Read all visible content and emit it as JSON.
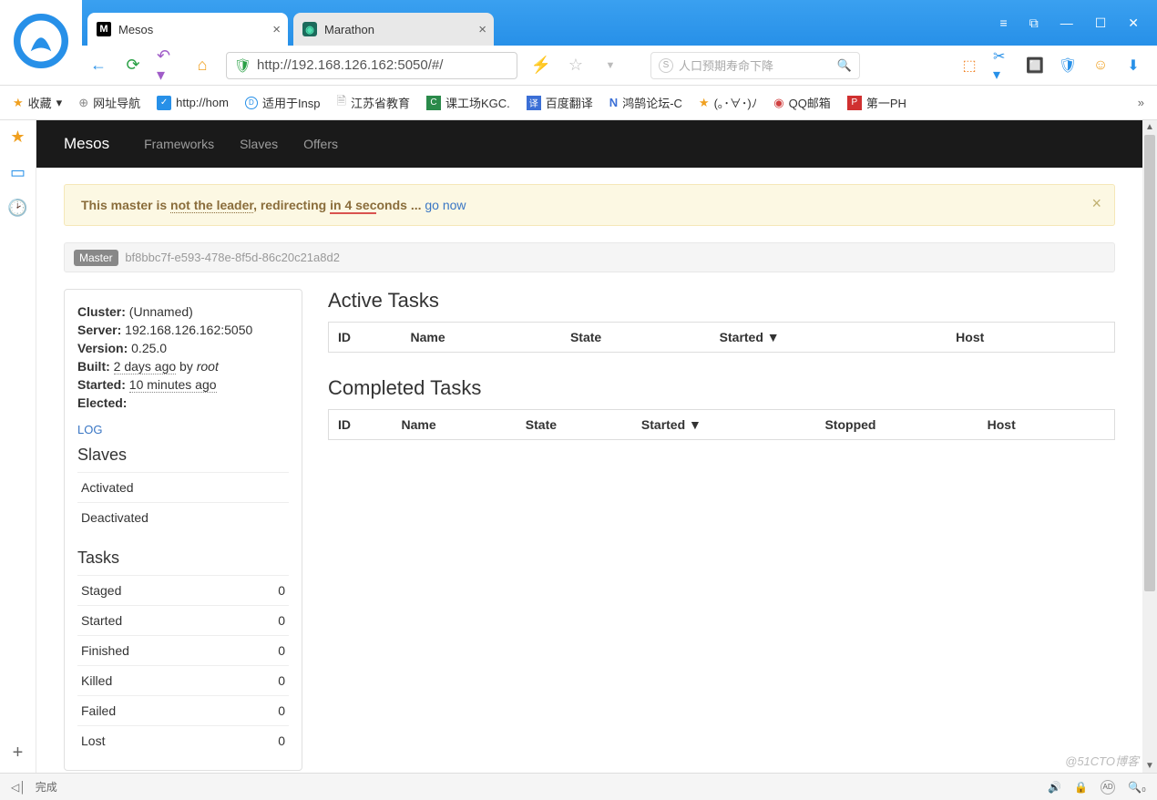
{
  "browser": {
    "tabs": [
      {
        "title": "Mesos",
        "active": true
      },
      {
        "title": "Marathon",
        "active": false
      }
    ],
    "url": "http://192.168.126.162:5050/#/",
    "search_placeholder": "人口预期寿命下降",
    "bookmarks": [
      {
        "label": "收藏"
      },
      {
        "label": "网址导航"
      },
      {
        "label": "http://hom"
      },
      {
        "label": "适用于Insp"
      },
      {
        "label": "江苏省教育"
      },
      {
        "label": "课工场KGC."
      },
      {
        "label": "百度翻译"
      },
      {
        "label": "鸿鹄论坛-C"
      },
      {
        "label": "(｡･∀･)ﾉ"
      },
      {
        "label": "QQ邮箱"
      },
      {
        "label": "第一PH"
      }
    ]
  },
  "nav": {
    "brand": "Mesos",
    "items": [
      "Frameworks",
      "Slaves",
      "Offers"
    ]
  },
  "alert": {
    "p1": "This master is ",
    "ntl": "not the leader",
    "p2": ", redirecting ",
    "red": "in 4 sec",
    "p3": "onds ... ",
    "link": "go now"
  },
  "master": {
    "badge": "Master",
    "id": "bf8bbc7f-e593-478e-8f5d-86c20c21a8d2"
  },
  "info": {
    "cluster_label": "Cluster:",
    "cluster_value": "(Unnamed)",
    "server_label": "Server:",
    "server_value": "192.168.126.162:5050",
    "version_label": "Version:",
    "version_value": "0.25.0",
    "built_label": "Built:",
    "built_value": "2 days ago",
    "built_by": " by ",
    "built_user": "root",
    "started_label": "Started:",
    "started_value": "10 minutes ago",
    "elected_label": "Elected:",
    "log_link": "LOG"
  },
  "slaves": {
    "heading": "Slaves",
    "rows": [
      "Activated",
      "Deactivated"
    ]
  },
  "tasks": {
    "heading": "Tasks",
    "rows": [
      {
        "label": "Staged",
        "count": 0
      },
      {
        "label": "Started",
        "count": 0
      },
      {
        "label": "Finished",
        "count": 0
      },
      {
        "label": "Killed",
        "count": 0
      },
      {
        "label": "Failed",
        "count": 0
      },
      {
        "label": "Lost",
        "count": 0
      }
    ]
  },
  "active_tasks": {
    "heading": "Active Tasks",
    "cols": [
      "ID",
      "Name",
      "State",
      "Started ▼",
      "Host",
      ""
    ]
  },
  "completed_tasks": {
    "heading": "Completed Tasks",
    "cols": [
      "ID",
      "Name",
      "State",
      "Started ▼",
      "Stopped",
      "Host",
      ""
    ]
  },
  "status": {
    "text": "完成",
    "watermark": "@51CTO博客"
  }
}
